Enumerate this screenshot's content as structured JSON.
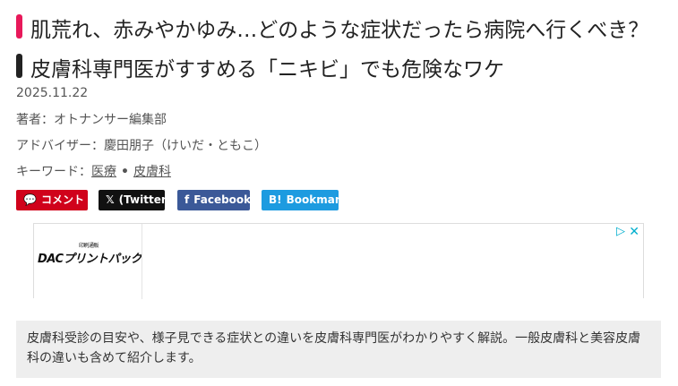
{
  "article": {
    "title": "肌荒れ、赤みやかゆみ…どのような症状だったら病院へ行くべき？　皮膚科専門医がすすめる「ニキビ」でも危険なワケ",
    "date": "2025.11.22",
    "author": "著者：オトナンサー編集部",
    "advisor": "アドバイザー：慶田朋子（けいだ・ともこ）",
    "keywords_label": "キーワード：",
    "keywords": [
      "医療",
      "皮膚科"
    ],
    "keyword_separator": "•",
    "summary": "皮膚科受診の目安や、様子見できる症状との違いを皮膚科専門医がわかりやすく解説。一般皮膚科と美容皮膚科の違いも含めて紹介します。"
  },
  "share": {
    "comment_label": "コメント",
    "x_label": "(Twitter)",
    "facebook_label": "Facebook",
    "bookmark_label": "Bookmark",
    "x_icon": "𝕏",
    "facebook_icon": "f",
    "bookmark_icon": "B!",
    "comment_icon": "💬"
  },
  "ad": {
    "logo_text": "DACプリントパック",
    "logo_small": "印刷通販",
    "choices_icon": "▷",
    "close_icon": "✕"
  },
  "colors": {
    "accent_pink": "#e8195a",
    "comment_red": "#d0021b",
    "x_black": "#111111",
    "facebook_blue": "#3b5998",
    "hatena_blue": "#1d9be0",
    "summary_bg": "#eeeeee"
  }
}
